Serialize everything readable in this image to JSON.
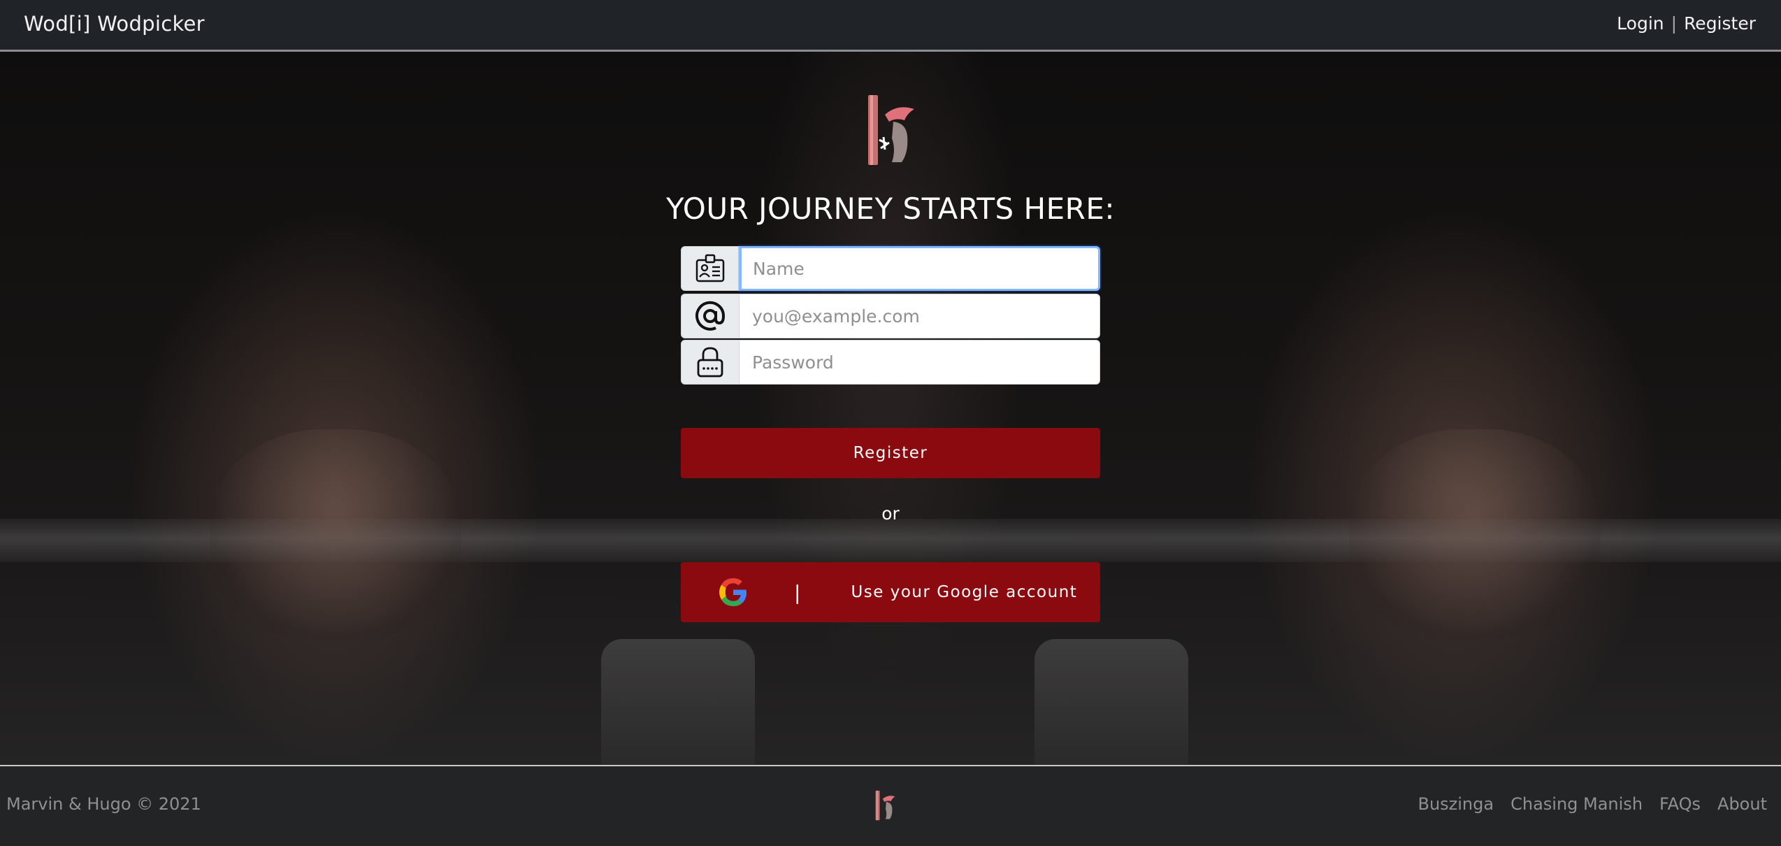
{
  "header": {
    "brand": "Wod[i] Wodpicker",
    "login_label": "Login",
    "separator": "|",
    "register_label": "Register"
  },
  "form": {
    "headline": "YOUR JOURNEY STARTS HERE:",
    "name_placeholder": "Name",
    "email_placeholder": "you@example.com",
    "password_placeholder": "Password",
    "register_button": "Register",
    "or_text": "or",
    "google_separator": "|",
    "google_button": "Use your Google account",
    "icons": [
      "id-card-icon",
      "at-sign-icon",
      "lock-icon",
      "google-icon"
    ]
  },
  "footer": {
    "copyright": "Marvin & Hugo © 2021",
    "links": [
      "Buszinga",
      "Chasing Manish",
      "FAQs",
      "About"
    ]
  },
  "colors": {
    "nav_bg": "#202328",
    "accent_red": "#8b0a0f",
    "footer_bg": "#222426",
    "logo_pink": "#e8888a"
  }
}
